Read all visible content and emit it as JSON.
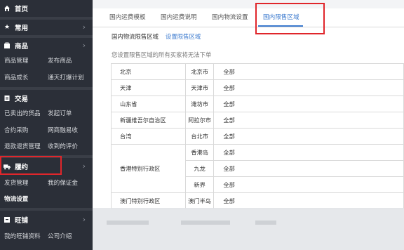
{
  "sidebar": {
    "home": "首页",
    "common": "常用",
    "goods": {
      "title": "商品",
      "items": [
        "商品管理",
        "发布商品",
        "商品成长",
        "通天打爆计划"
      ]
    },
    "trade": {
      "title": "交易",
      "items": [
        "已卖出的货品",
        "发起订单",
        "合约采购",
        "网商融易收",
        "退款退货管理",
        "收到的评价"
      ]
    },
    "fulfill": {
      "title": "履约",
      "items": [
        "发货管理",
        "我的保证金",
        "物流设置"
      ]
    },
    "wangpu": {
      "title": "旺铺",
      "items": [
        "我的旺铺资料",
        "公司介绍"
      ]
    }
  },
  "tabs": [
    "国内运费模板",
    "国内运费说明",
    "国内物流设置",
    "国内限售区域"
  ],
  "active_tab": "国内限售区域",
  "breadcrumb": "国内物流限售区域",
  "breadcrumb_link": "设置限售区域",
  "note": "您设置限售区域的所有买家将无法下单",
  "zones": [
    {
      "province": "北京",
      "cities": [
        {
          "city": "北京市",
          "scope": "全部"
        }
      ]
    },
    {
      "province": "天津",
      "cities": [
        {
          "city": "天津市",
          "scope": "全部"
        }
      ]
    },
    {
      "province": "山东省",
      "cities": [
        {
          "city": "潍坊市",
          "scope": "全部"
        }
      ]
    },
    {
      "province": "新疆维吾尔自治区",
      "cities": [
        {
          "city": "阿拉尔市",
          "scope": "全部"
        }
      ]
    },
    {
      "province": "台湾",
      "cities": [
        {
          "city": "台北市",
          "scope": "全部"
        }
      ]
    },
    {
      "province": "香港特别行政区",
      "cities": [
        {
          "city": "香港岛",
          "scope": "全部"
        },
        {
          "city": "九龙",
          "scope": "全部"
        },
        {
          "city": "新界",
          "scope": "全部"
        }
      ]
    },
    {
      "province": "澳门特别行政区",
      "cities": [
        {
          "city": "澳门半岛",
          "scope": "全部"
        }
      ]
    }
  ],
  "colors": {
    "accent": "#3d7bcf",
    "highlight": "#e0262b",
    "sidebar_bg": "#2b2f38"
  }
}
